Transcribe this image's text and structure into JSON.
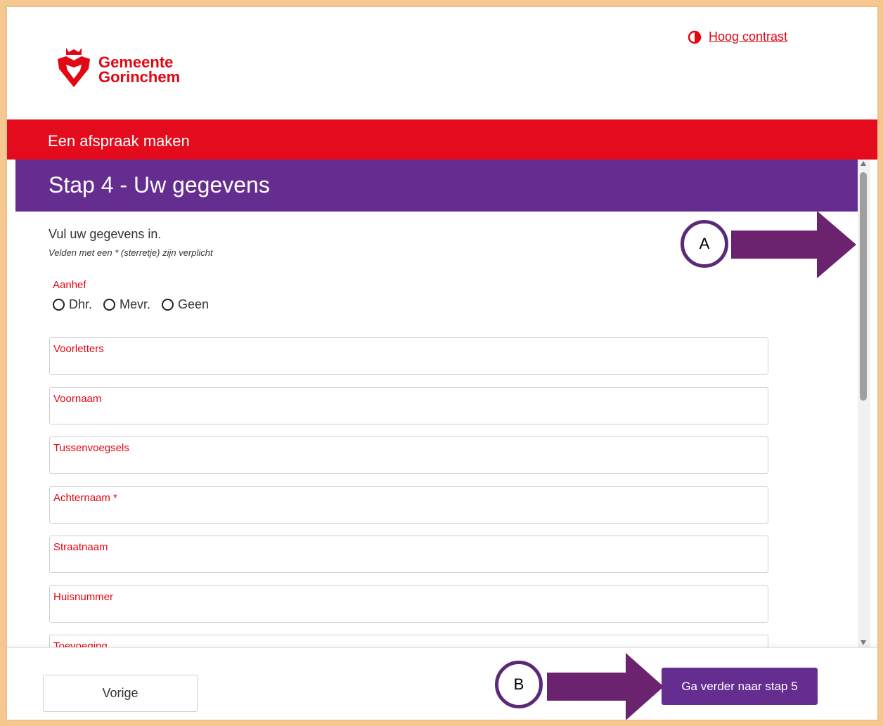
{
  "header": {
    "logo_line1": "Gemeente",
    "logo_line2": "Gorinchem",
    "contrast_link": "Hoog contrast"
  },
  "banner": {
    "title": "Een afspraak maken"
  },
  "step": {
    "title": "Stap 4 - Uw gegevens"
  },
  "form": {
    "intro": "Vul uw gegevens in.",
    "required_note": "Velden met een * (sterretje) zijn verplicht",
    "salutation_label": "Aanhef",
    "salutation_options": [
      "Dhr.",
      "Mevr.",
      "Geen"
    ],
    "fields": [
      {
        "label": "Voorletters",
        "value": ""
      },
      {
        "label": "Voornaam",
        "value": ""
      },
      {
        "label": "Tussenvoegsels",
        "value": ""
      },
      {
        "label": "Achternaam *",
        "value": ""
      },
      {
        "label": "Straatnaam",
        "value": ""
      },
      {
        "label": "Huisnummer",
        "value": ""
      },
      {
        "label": "Toevoeging",
        "value": ""
      }
    ]
  },
  "footer": {
    "prev_label": "Vorige",
    "next_label": "Ga verder naar stap 5"
  },
  "annotations": {
    "a_label": "A",
    "b_label": "B",
    "arrow_color": "#6b2370"
  },
  "colors": {
    "brand_red": "#e30613",
    "brand_purple": "#662d91",
    "frame_border": "#f5c890"
  }
}
